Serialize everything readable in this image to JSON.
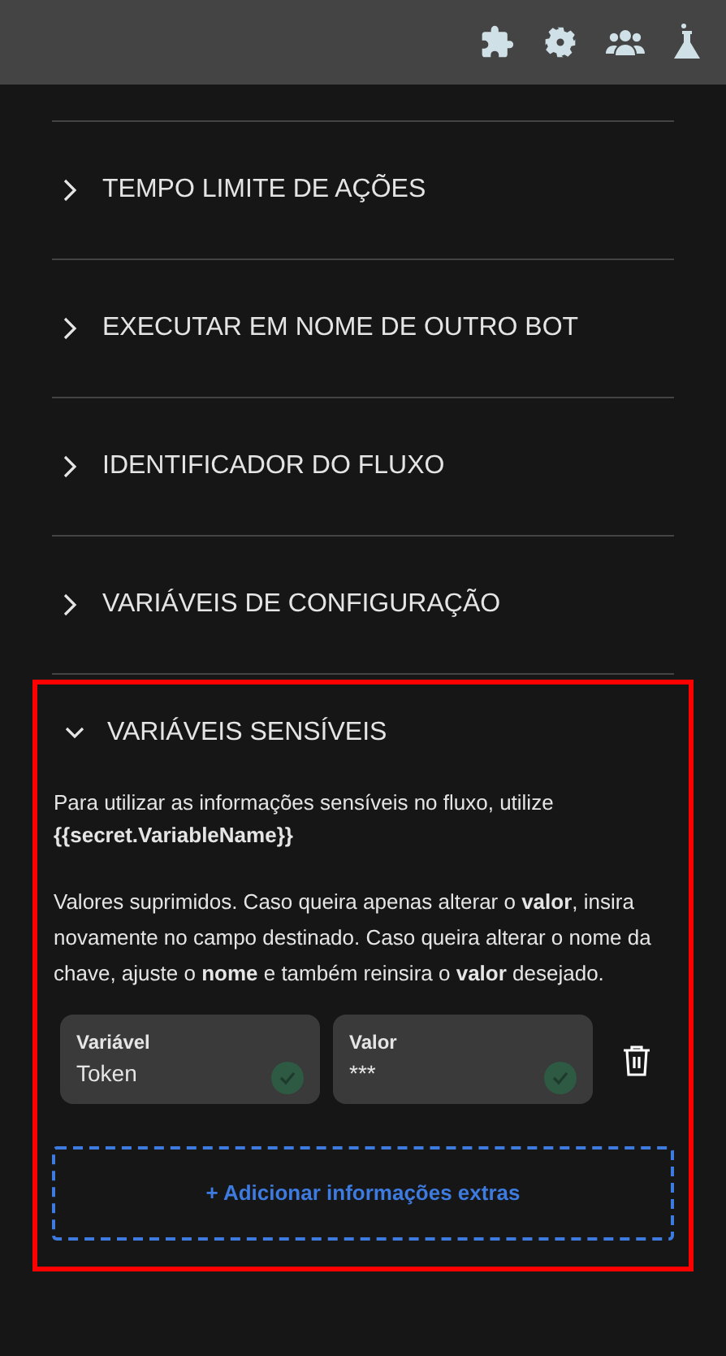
{
  "toolbar": {
    "icons": [
      {
        "kind": "puzzle"
      },
      {
        "kind": "gear"
      },
      {
        "kind": "users"
      },
      {
        "kind": "flask"
      }
    ]
  },
  "sections": [
    {
      "title": "TEMPO LIMITE DE AÇÕES",
      "expanded": false
    },
    {
      "title": "EXECUTAR EM NOME DE OUTRO BOT",
      "expanded": false
    },
    {
      "title": "IDENTIFICADOR DO FLUXO",
      "expanded": false
    },
    {
      "title": "VARIÁVEIS DE CONFIGURAÇÃO",
      "expanded": false
    },
    {
      "title": "VARIÁVEIS SENSÍVEIS",
      "expanded": true,
      "highlighted": true,
      "intro": "Para utilizar as informações sensíveis no fluxo, utilize",
      "code": "{{secret.VariableName}}",
      "note": "Valores suprimidos. Caso queira apenas alterar o **valor**, insira novamente no campo destinado. Caso queira alterar o nome da chave, ajuste o **nome** e também reinsira o **valor** desejado.",
      "rows": [
        {
          "fields": [
            {
              "label": "Variável",
              "value": "Token",
              "valid": true
            },
            {
              "label": "Valor",
              "value": "***",
              "valid": true
            }
          ]
        }
      ],
      "add_button": "+ Adicionar informações extras"
    }
  ]
}
